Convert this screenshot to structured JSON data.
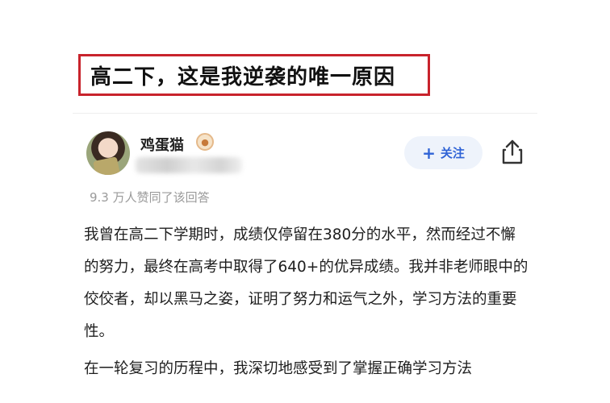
{
  "headline": "高二下，这是我逆袭的唯一原因",
  "author": {
    "name": "鸡蛋猫",
    "badge_icon": "medal-icon"
  },
  "follow_button": {
    "icon": "plus",
    "label": "关注"
  },
  "share_icon": "share-icon",
  "likes_text": "9.3 万人赞同了该回答",
  "paragraphs": [
    "我曾在高二下学期时，成绩仅停留在380分的水平，然而经过不懈的努力，最终在高考中取得了640+的优异成绩。我并非老师眼中的佼佼者，却以黑马之姿，证明了努力和运气之外，学习方法的重要性。",
    "在一轮复习的历程中，我深切地感受到了掌握正确学习方法"
  ],
  "colors": {
    "title_border": "#c8232c",
    "follow_text": "#2f63d6",
    "follow_bg": "#eef3fb"
  }
}
